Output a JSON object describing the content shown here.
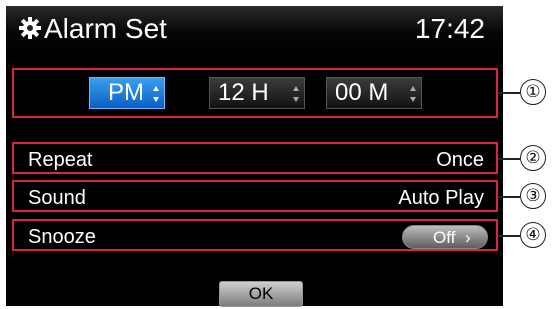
{
  "header": {
    "title": "Alarm Set",
    "clock": "17:42",
    "icon": "gear-icon"
  },
  "time_picker": {
    "period": "PM",
    "hour": "12 H",
    "minute": "00 M"
  },
  "settings": [
    {
      "label": "Repeat",
      "value": "Once"
    },
    {
      "label": "Sound",
      "value": "Auto Play"
    },
    {
      "label": "Snooze",
      "value": "Off"
    }
  ],
  "ok_label": "OK",
  "callouts": [
    "①",
    "②",
    "③",
    "④"
  ],
  "colors": {
    "highlight": "#d8263a",
    "active_spinner": "#1a7ee0",
    "screen_bg": "#000000"
  }
}
